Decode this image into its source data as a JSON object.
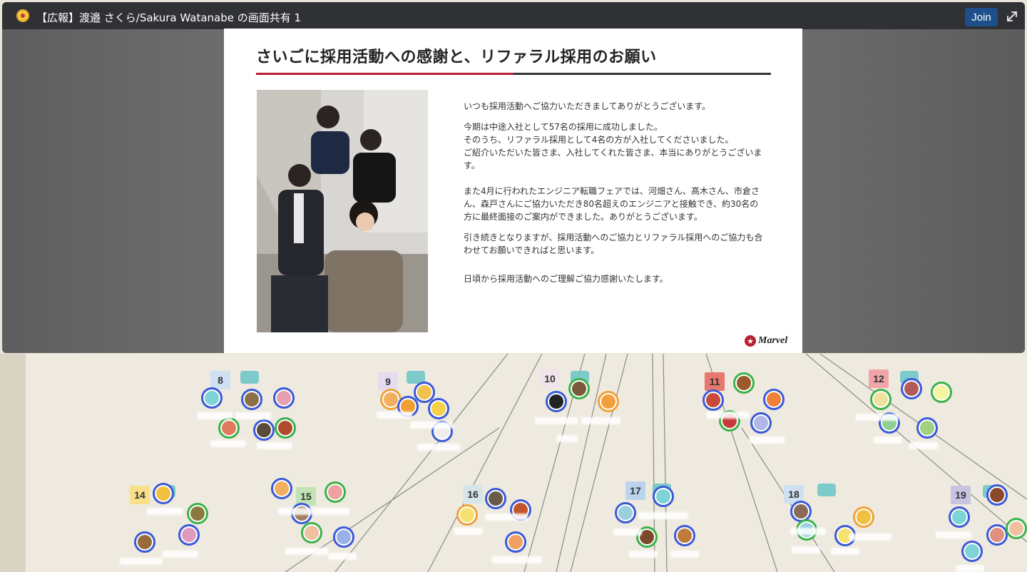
{
  "share": {
    "title": "【広報】渡邉 さくら/Sakura Watanabe の画面共有 1",
    "join_label": "Join"
  },
  "slide": {
    "title": "さいごに採用活動への感謝と、リファラル採用のお願い",
    "paragraphs": [
      "いつも採用活動へご協力いただきましてありがとうございます。",
      "今期は中途入社として57名の採用に成功しました。\nそのうち、リファラル採用として4名の方が入社してくださいました。\nご紹介いただいた皆さま、入社してくれた皆さま、本当にありがとうございます。",
      "また4月に行われたエンジニア転職フェアでは、河畑さん、髙木さん、市倉さん、森戸さんにご協力いただき80名超えのエンジニアと接触でき、約30名の方に最終面接のご案内ができました。ありがとうございます。",
      "引き続きとなりますが、採用活動へのご協力とリファラル採用へのご協力も合わせてお願いできればと思います。",
      "日頃から採用活動へのご理解ご協力感謝いたします。"
    ],
    "logo_text": "Marvel"
  },
  "tables": [
    {
      "label": "8",
      "color": "#cfe0f3"
    },
    {
      "label": "9",
      "color": "#e6dcef"
    },
    {
      "label": "10",
      "color": "#f0e4ea"
    },
    {
      "label": "11",
      "color": "#e7786e"
    },
    {
      "label": "12",
      "color": "#f0a6a9"
    },
    {
      "label": "14",
      "color": "#f8e08a"
    },
    {
      "label": "15",
      "color": "#bfe3b4"
    },
    {
      "label": "16",
      "color": "#d6e6e8"
    },
    {
      "label": "17",
      "color": "#bcd3ee"
    },
    {
      "label": "18",
      "color": "#cfe0f3"
    },
    {
      "label": "19",
      "color": "#c9c3e2"
    }
  ],
  "colors": {
    "accent_red": "#b8202f",
    "join_button": "#1e4f8a",
    "title_bar": "#303134"
  },
  "icons": {
    "app_logo": "gather-logo-icon",
    "expand": "expand-icon",
    "brand_star": "star-icon"
  }
}
